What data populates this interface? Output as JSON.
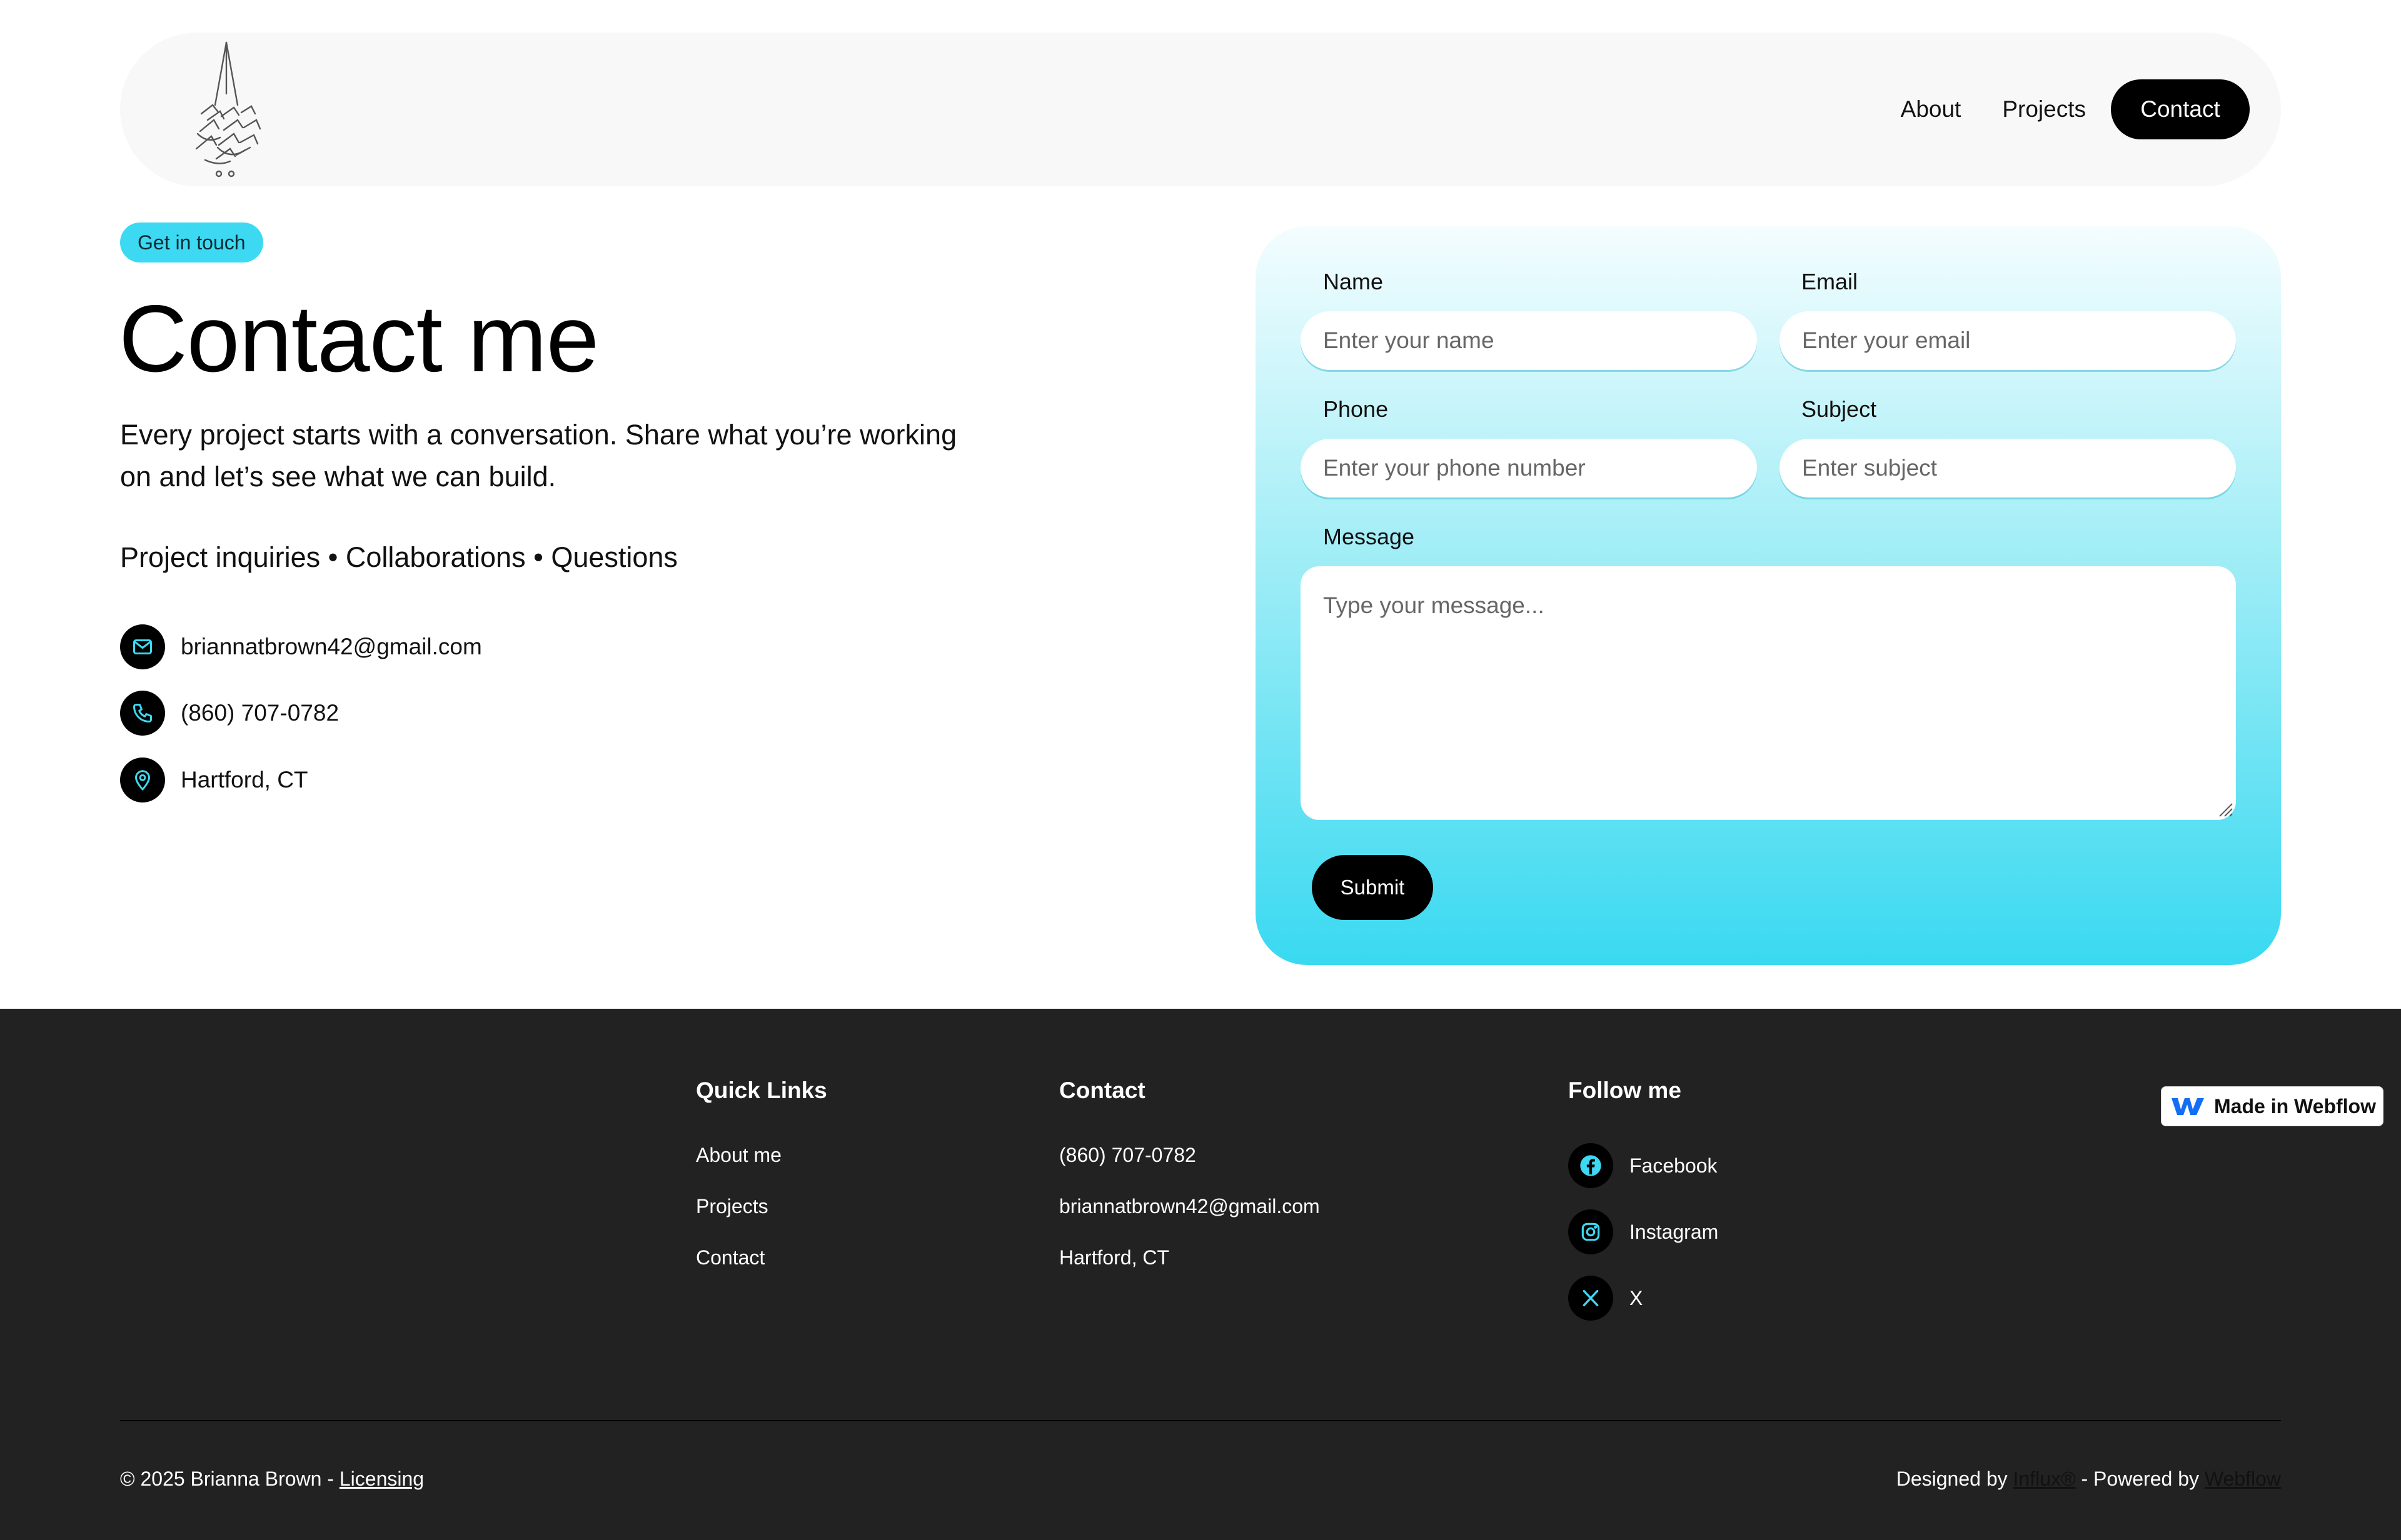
{
  "nav": {
    "links": [
      "About",
      "Projects"
    ],
    "contact_label": "Contact"
  },
  "hero": {
    "badge": "Get in touch",
    "title": "Contact me",
    "lead": "Every project starts with a conversation. Share what you’re working on and let’s see what we can build.",
    "services": "Project inquiries • Collaborations • Questions"
  },
  "contact_info": {
    "email": "briannatbrown42@gmail.com",
    "phone": "(860) 707-0782",
    "location": "Hartford, CT"
  },
  "form": {
    "name_label": "Name",
    "name_placeholder": "Enter your name",
    "email_label": "Email",
    "email_placeholder": "Enter your email",
    "phone_label": "Phone",
    "phone_placeholder": "Enter your phone number",
    "subject_label": "Subject",
    "subject_placeholder": "Enter subject",
    "message_label": "Message",
    "message_placeholder": "Type your message...",
    "submit_label": "Submit"
  },
  "footer": {
    "quick_links_title": "Quick Links",
    "quick_links": [
      "About me",
      "Projects",
      "Contact"
    ],
    "contact_title": "Contact",
    "contact_items": [
      "(860) 707-0782",
      "briannatbrown42@gmail.com",
      "Hartford, CT"
    ],
    "follow_title": "Follow me",
    "social": [
      "Facebook",
      "Instagram",
      "X"
    ],
    "copyright": "© 2025 Brianna Brown - ",
    "licensing": "Licensing",
    "designed_by": "Designed by ",
    "designer": "Influx®",
    "powered_by": " - Powered by ",
    "platform": "Webflow",
    "webflow_badge": "Made in Webflow"
  },
  "colors": {
    "accent": "#3dd9f2",
    "footer_bg": "#222222",
    "button": "#000000"
  },
  "icons": [
    "mail-icon",
    "phone-icon",
    "location-pin-icon",
    "facebook-icon",
    "instagram-icon",
    "x-icon",
    "webflow-logo-icon"
  ]
}
